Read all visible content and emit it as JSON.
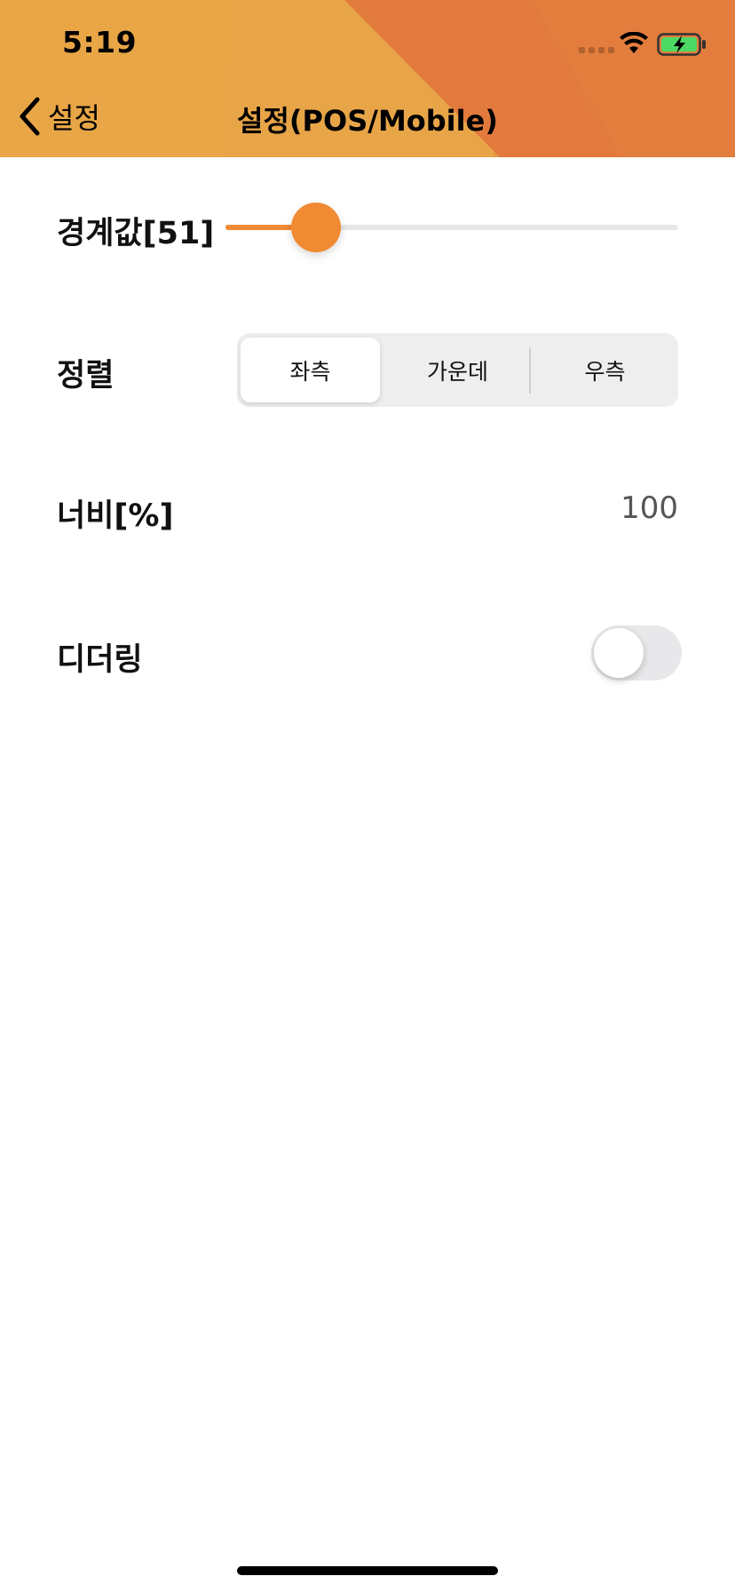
{
  "status_bar": {
    "time": "5:19"
  },
  "nav": {
    "back_label": "설정",
    "title": "설정(POS/Mobile)"
  },
  "settings": {
    "threshold": {
      "label": "경계값[51]",
      "value": 51,
      "min": 0,
      "max": 255
    },
    "alignment": {
      "label": "정렬",
      "options": [
        "좌측",
        "가운데",
        "우측"
      ],
      "selected": "좌측"
    },
    "width": {
      "label": "너비[%]",
      "value": "100"
    },
    "dithering": {
      "label": "디더링",
      "enabled": false
    }
  },
  "colors": {
    "accent": "#f08a33",
    "header_light": "#e9a646",
    "header_dark": "#e27a3d"
  },
  "icons": {
    "back": "chevron-left-icon",
    "wifi": "wifi-icon",
    "battery": "battery-charging-icon",
    "cellular": "cellular-signal-icon"
  }
}
